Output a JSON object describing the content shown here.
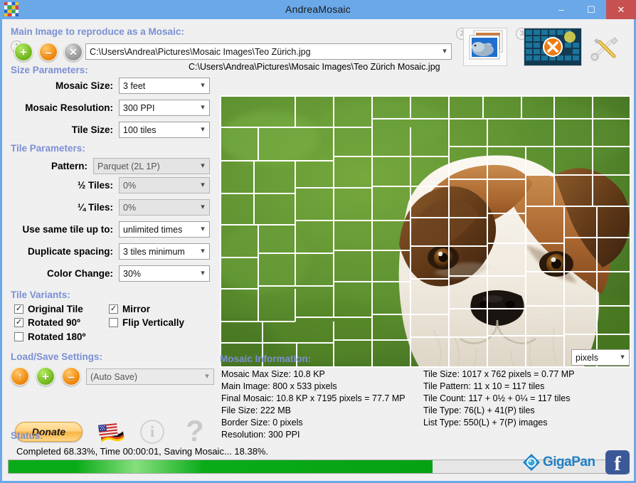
{
  "window": {
    "title": "AndreaMosaic",
    "app_icon": "mosaic-grid-icon",
    "minimize": "–",
    "maximize": "☐",
    "close": "✕"
  },
  "main_image": {
    "group_label": "Main Image to reproduce as a Mosaic:",
    "add_button": "+",
    "remove_button": "–",
    "clear_button": "✕",
    "count_badge": "1",
    "path_value": "C:\\Users\\Andrea\\Pictures\\Mosaic Images\\Teo Zürich.jpg",
    "output_path": "C:\\Users\\Andrea\\Pictures\\Mosaic Images\\Teo Zürich Mosaic.jpg",
    "tiles_button_badge": "2",
    "mosaic_button_badge": "3",
    "tiles_button_name": "select-tile-images-button",
    "mosaic_button_name": "create-mosaic-button",
    "tools_button_name": "tools-button"
  },
  "size_parameters": {
    "group_label": "Size Parameters:",
    "fields": [
      {
        "label": "Mosaic Size:",
        "value": "3 feet",
        "disabled": false
      },
      {
        "label": "Mosaic Resolution:",
        "value": "300 PPI",
        "disabled": false
      },
      {
        "label": "Tile Size:",
        "value": "100 tiles",
        "disabled": false
      }
    ]
  },
  "tile_parameters": {
    "group_label": "Tile Parameters:",
    "fields": [
      {
        "label": "Pattern:",
        "value": "Parquet (2L 1P)",
        "disabled": true
      },
      {
        "label": "½ Tiles:",
        "value": "0%",
        "disabled": true
      },
      {
        "label": "¼ Tiles:",
        "value": "0%",
        "disabled": true
      },
      {
        "label": "Use same tile up to:",
        "value": "unlimited times",
        "disabled": false
      },
      {
        "label": "Duplicate spacing:",
        "value": "3 tiles minimum",
        "disabled": false
      },
      {
        "label": "Color Change:",
        "value": "30%",
        "disabled": false
      }
    ]
  },
  "tile_variants": {
    "group_label": "Tile Variants:",
    "items": [
      {
        "label": "Original Tile",
        "checked": true
      },
      {
        "label": "Mirror",
        "checked": true
      },
      {
        "label": "Rotated 90º",
        "checked": true
      },
      {
        "label": "Flip Vertically",
        "checked": false
      },
      {
        "label": "Rotated 180º",
        "checked": false
      }
    ]
  },
  "load_save": {
    "group_label": "Load/Save Settings:",
    "load_button": "↑",
    "add_button": "+",
    "remove_button": "–",
    "profile_value": "(Auto Save)",
    "donate_label": "Donate",
    "language_icon": "flags-icon",
    "info_icon": "info-icon",
    "help_icon": "help-icon",
    "info_glyph": "i",
    "help_glyph": "?"
  },
  "mosaic_information": {
    "group_label": "Mosaic Information:",
    "units_value": "pixels",
    "left_column": [
      "Mosaic Max Size: 10.8 KP",
      "Main Image: 800 x 533 pixels",
      "Final Mosaic: 10.8 KP x 7195 pixels = 77.7 MP",
      "File Size: 222 MB",
      "Border Size: 0 pixels",
      "Resolution: 300 PPI"
    ],
    "right_column": [
      "Tile Size: 1017 x 762 pixels = 0.77 MP",
      "Tile Pattern: 11 x 10 = 117 tiles",
      "Tile Count: 117 + 0½ + 0¼ = 117 tiles",
      "Tile Type: 76(L) + 41(P) tiles",
      "List Type: 550(L) + 7(P) images"
    ]
  },
  "status": {
    "group_label": "Status:",
    "text": "Completed 68.33%, Time 00:00:01, Saving Mosaic... 18.38%.",
    "progress_percent": 68.33
  },
  "branding": {
    "gigapan_label": "GigaPan",
    "facebook_glyph": "f"
  },
  "colors": {
    "titlebar": "#6aa8e8",
    "close_button": "#c75050",
    "group_label": "#7b8fd4",
    "progress": "#0aab18",
    "facebook": "#3b5998",
    "gigapan": "#1f7fc4"
  }
}
